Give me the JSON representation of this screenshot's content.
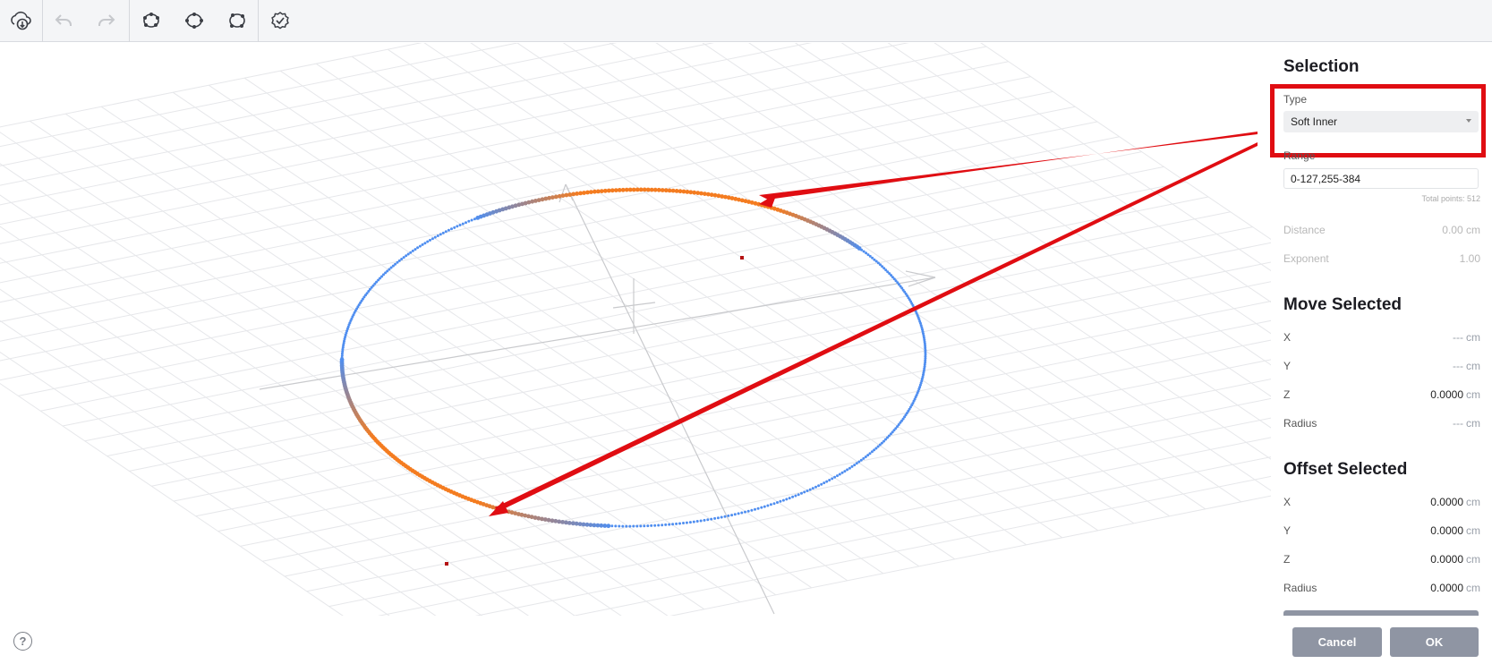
{
  "toolbar": {
    "buttons": [
      {
        "name": "cloud-download-icon"
      },
      {
        "name": "undo-icon"
      },
      {
        "name": "redo-icon"
      },
      {
        "name": "select-points-icon"
      },
      {
        "name": "select-loop-icon"
      },
      {
        "name": "select-ring-icon"
      },
      {
        "name": "confirm-check-icon"
      }
    ]
  },
  "panel": {
    "selection": {
      "title": "Selection",
      "type_label": "Type",
      "type_value": "Soft Inner",
      "range_label": "Range",
      "range_value": "0-127,255-384",
      "total_points": "Total points: 512",
      "distance_label": "Distance",
      "distance_value": "0.00",
      "exponent_label": "Exponent",
      "exponent_value": "1.00"
    },
    "move": {
      "title": "Move Selected",
      "rows": [
        {
          "label": "X",
          "value": "---"
        },
        {
          "label": "Y",
          "value": "---"
        },
        {
          "label": "Z",
          "value": "0.0000"
        },
        {
          "label": "Radius",
          "value": "---"
        }
      ]
    },
    "offset": {
      "title": "Offset Selected",
      "rows": [
        {
          "label": "X",
          "value": "0.0000"
        },
        {
          "label": "Y",
          "value": "0.0000"
        },
        {
          "label": "Z",
          "value": "0.0000"
        },
        {
          "label": "Radius",
          "value": "0.0000"
        }
      ]
    },
    "unit": "cm"
  },
  "footer": {
    "help": "?",
    "cancel": "Cancel",
    "ok": "OK"
  },
  "colors": {
    "selected": "#f47c20",
    "unselected": "#4f8ef0",
    "annotation": "#e00d12"
  }
}
